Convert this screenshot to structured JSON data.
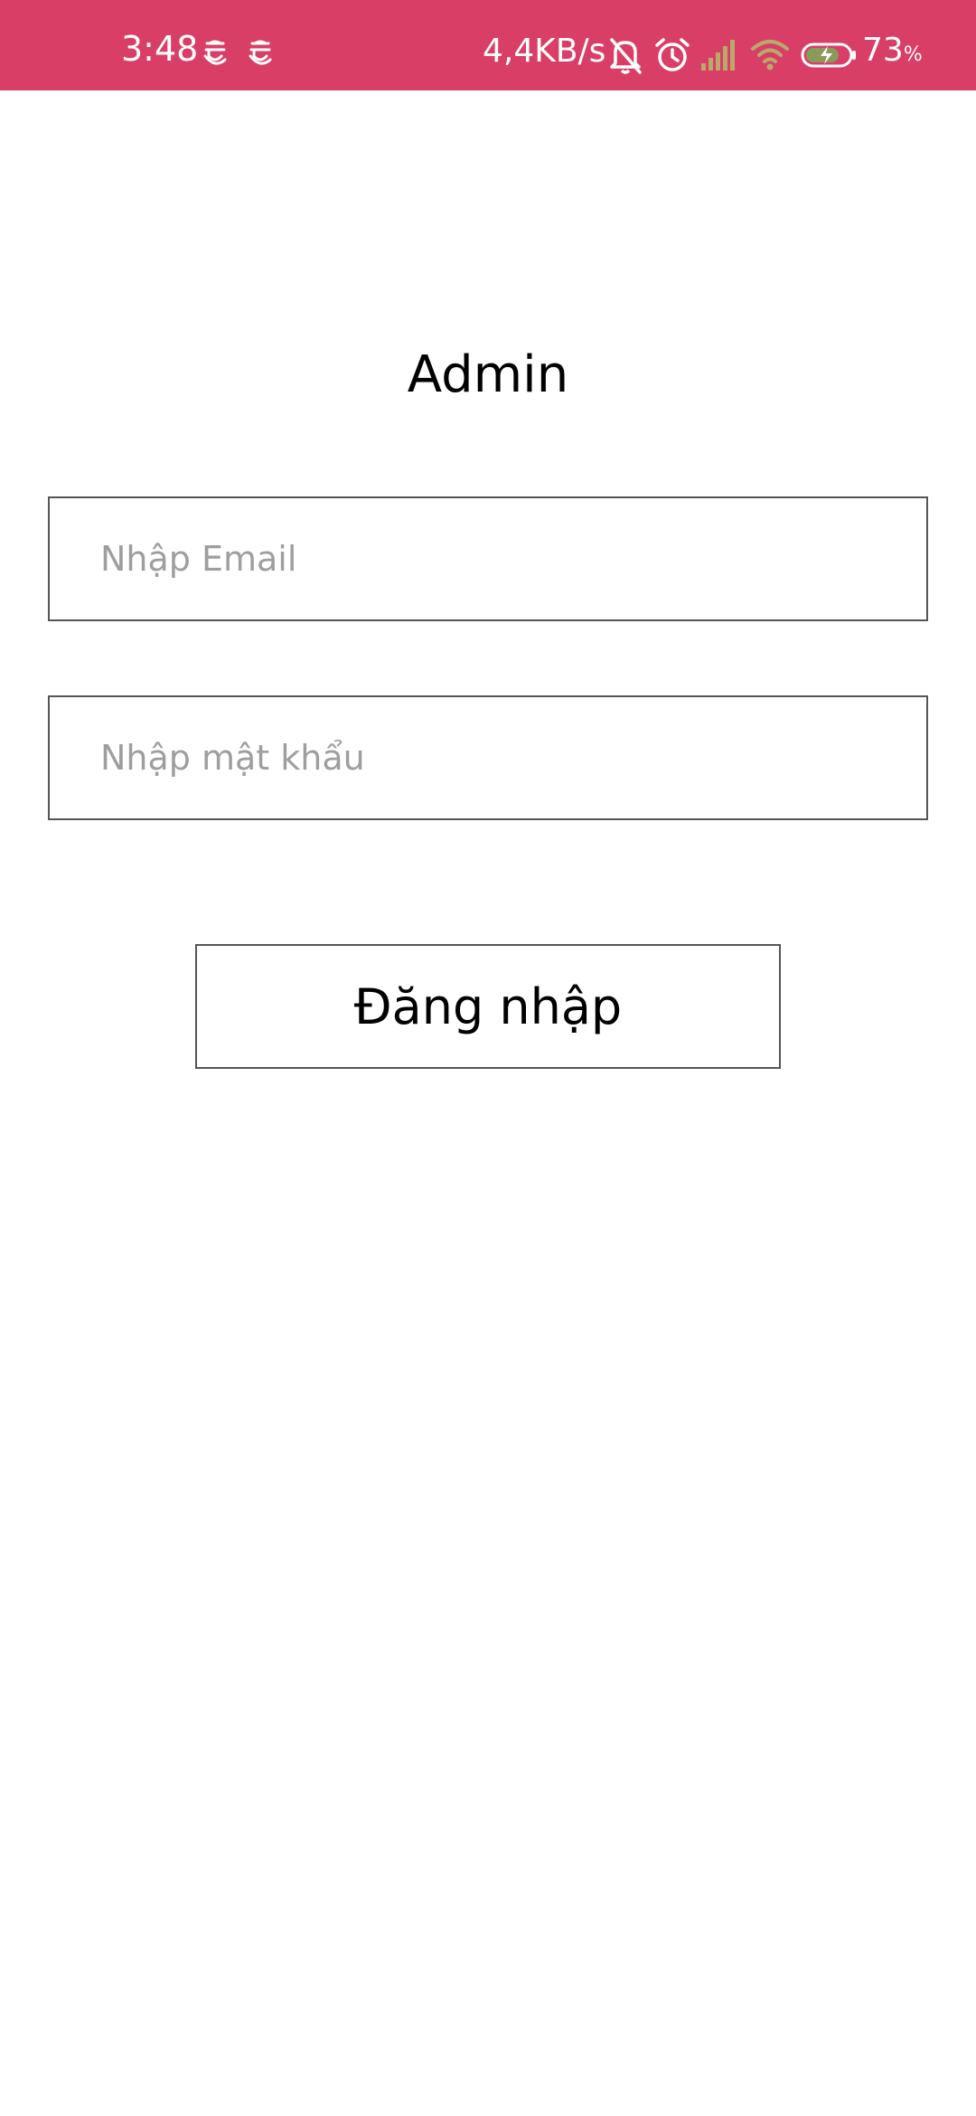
{
  "status_bar": {
    "time": "3:48",
    "speed": "4,4KB/s",
    "battery_level": "73",
    "battery_unit": "%",
    "background_color": "#d93e66",
    "icons": [
      "app-notification-icon",
      "app-notification-icon",
      "bell-muted-icon",
      "alarm-icon",
      "signal-icon",
      "wifi-icon",
      "battery-charging-icon"
    ]
  },
  "screen": {
    "title": "Admin"
  },
  "form": {
    "email_placeholder": "Nhập Email",
    "email_value": "",
    "password_placeholder": "Nhập mật khẩu",
    "password_value": "",
    "login_label": "Đăng nhập"
  }
}
